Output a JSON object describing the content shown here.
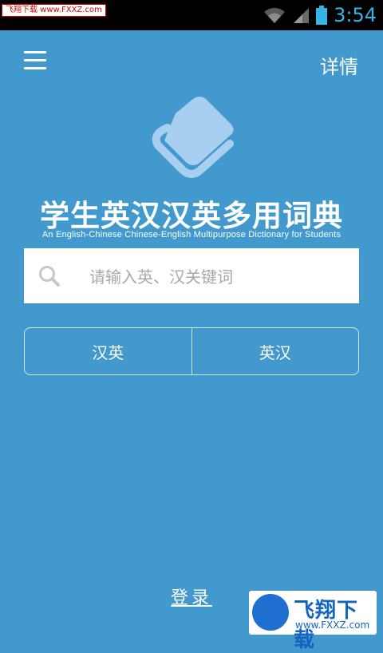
{
  "status_bar": {
    "watermark": "飞翔下载 www.FXXZ.com",
    "time": "3:54"
  },
  "header": {
    "details_label": "详情"
  },
  "app": {
    "title": "学生英汉汉英多用词典",
    "subtitle": "An English-Chinese Chinese-English Multipurpose  Dictionary for  Students"
  },
  "search": {
    "placeholder": "请输入英、汉关键词"
  },
  "segments": {
    "chinese_english": "汉英",
    "english_chinese": "英汉"
  },
  "login": {
    "label": "登录"
  },
  "watermark_bottom": {
    "title": "飞翔下载",
    "url": "www.FXXZ.com"
  },
  "colors": {
    "background": "#4299ce",
    "status_bar": "#000000",
    "status_accent": "#33b5e5"
  }
}
